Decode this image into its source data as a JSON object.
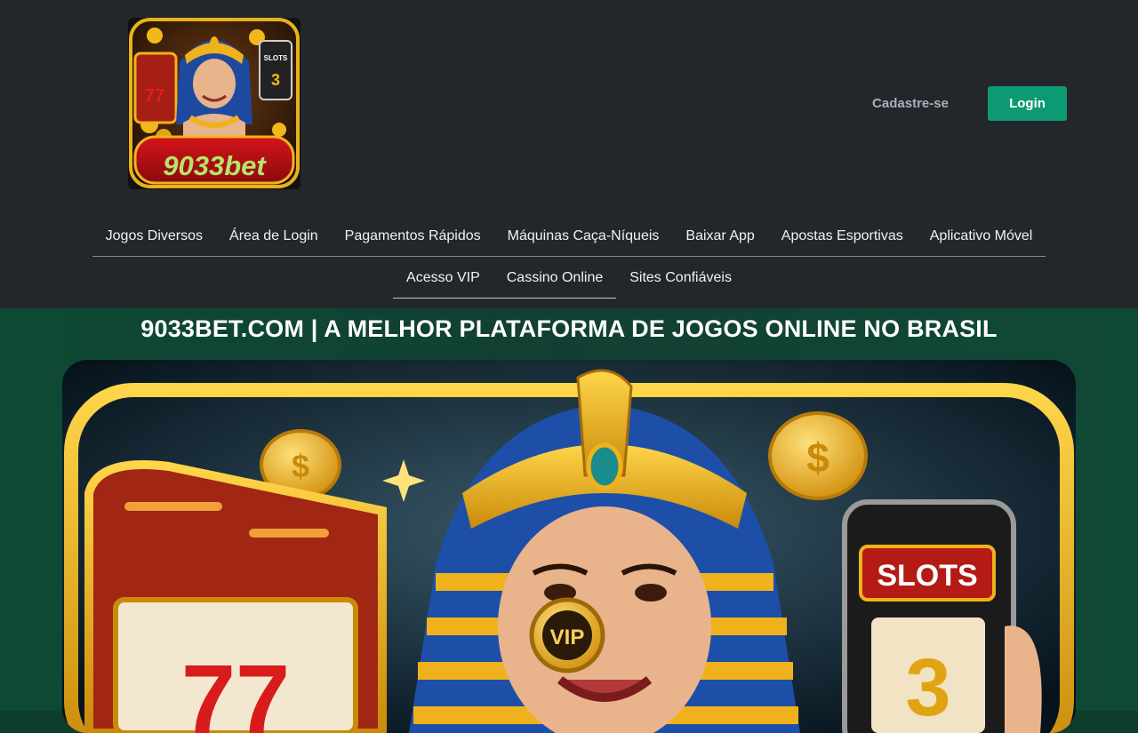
{
  "header": {
    "logo_text": "9033bet",
    "register_label": "Cadastre-se",
    "login_label": "Login"
  },
  "nav": {
    "row1": [
      {
        "label": "Jogos Diversos"
      },
      {
        "label": "Área de Login"
      },
      {
        "label": "Pagamentos Rápidos"
      },
      {
        "label": "Máquinas Caça-Níqueis"
      },
      {
        "label": "Baixar App"
      },
      {
        "label": "Apostas Esportivas"
      },
      {
        "label": "Aplicativo Móvel"
      }
    ],
    "row2": [
      {
        "label": "Acesso VIP",
        "active": true
      },
      {
        "label": "Cassino Online",
        "active": true
      },
      {
        "label": "Sites Confiáveis"
      }
    ]
  },
  "hero": {
    "title": "9033BET.COM | A MELHOR PLATAFORMA DE JOGOS ONLINE NO BRASIL",
    "banner_badge": "VIP",
    "banner_phone_text": "SLOTS",
    "banner_reel_text": "77",
    "banner_phone_digit": "3"
  },
  "colors": {
    "header_bg": "#23262b",
    "login_bg": "#0d9a73",
    "hero_bg": "#0f4a36",
    "gold": "#e8b21a"
  }
}
